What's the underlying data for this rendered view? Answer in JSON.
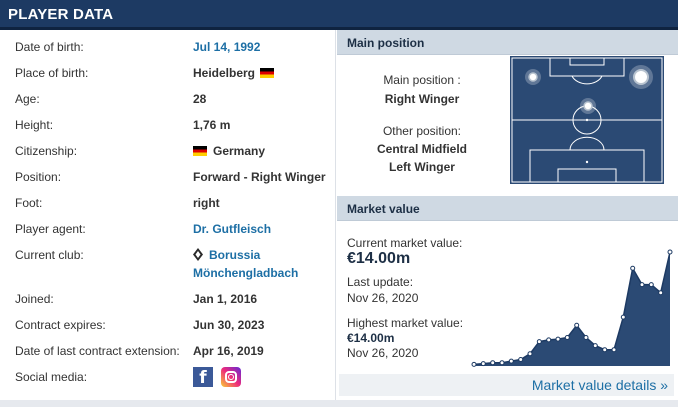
{
  "header": {
    "title": "PLAYER DATA"
  },
  "player": {
    "date_of_birth": {
      "label": "Date of birth:",
      "value": "Jul 14, 1992"
    },
    "place_of_birth": {
      "label": "Place of birth:",
      "value": "Heidelberg"
    },
    "age": {
      "label": "Age:",
      "value": "28"
    },
    "height": {
      "label": "Height:",
      "value": "1,76 m"
    },
    "citizenship": {
      "label": "Citizenship:",
      "value": "Germany"
    },
    "position": {
      "label": "Position:",
      "value": "Forward - Right Winger"
    },
    "foot": {
      "label": "Foot:",
      "value": "right"
    },
    "agent": {
      "label": "Player agent:",
      "value": "Dr. Gutfleisch"
    },
    "club": {
      "label": "Current club:",
      "value_line1": "Borussia",
      "value_line2": "Mönchengladbach"
    },
    "joined": {
      "label": "Joined:",
      "value": "Jan 1, 2016"
    },
    "contract_expires": {
      "label": "Contract expires:",
      "value": "Jun 30, 2023"
    },
    "last_extension": {
      "label": "Date of last contract extension:",
      "value": "Apr 16, 2019"
    },
    "social": {
      "label": "Social media:",
      "icons": [
        "facebook-icon",
        "instagram-icon"
      ]
    }
  },
  "main_position": {
    "heading": "Main position",
    "main_label": "Main position :",
    "main_value": "Right Winger",
    "other_label": "Other position:",
    "other_values": [
      "Central Midfield",
      "Left Winger"
    ]
  },
  "market_value": {
    "heading": "Market value",
    "current_label": "Current market value:",
    "current_value": "€14.00m",
    "last_update_label": "Last update:",
    "last_update_value": "Nov 26, 2020",
    "highest_label": "Highest market value:",
    "highest_value": "€14.00m",
    "highest_date": "Nov 26, 2020",
    "details_link": "Market value details »"
  },
  "colors": {
    "header_bg": "#1d3a63",
    "panel_head_bg": "#cfd9e3",
    "pitch": "#2b4a74",
    "link": "#1d6fa5"
  },
  "chart_data": {
    "type": "area",
    "title": "",
    "xlabel": "",
    "ylabel": "",
    "series": [
      {
        "values": [
          0.2,
          0.3,
          0.4,
          0.4,
          0.6,
          0.8,
          1.5,
          3.0,
          3.2,
          3.3,
          3.5,
          5.0,
          3.5,
          2.5,
          2.0,
          2.0,
          6.0,
          12.0,
          10.0,
          10.0,
          9.0,
          14.0
        ]
      }
    ]
  }
}
